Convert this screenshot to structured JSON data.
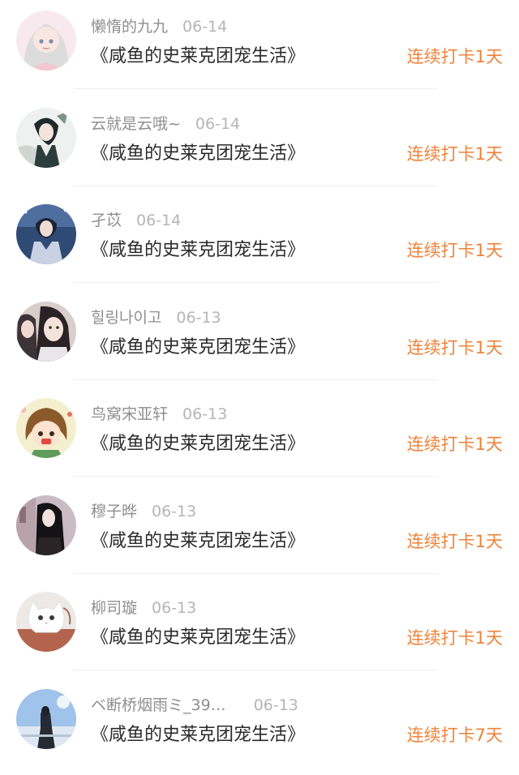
{
  "book_title": "《咸鱼的史莱克团宠生活》",
  "accent_color": "#f0833a",
  "entries": [
    {
      "username": "懒惰的九九",
      "date": "06-14",
      "streak": "连续打卡1天",
      "avatar_icon": "anime-girl-avatar"
    },
    {
      "username": "云就是云哦~",
      "date": "06-14",
      "streak": "连续打卡1天",
      "avatar_icon": "anime-boy-avatar"
    },
    {
      "username": "孑苡",
      "date": "06-14",
      "streak": "连续打卡1天",
      "avatar_icon": "anime-boy-night-avatar"
    },
    {
      "username": "힐링나이고",
      "date": "06-13",
      "streak": "连续打卡1天",
      "avatar_icon": "selfie-avatar"
    },
    {
      "username": "鸟窝宋亚轩",
      "date": "06-13",
      "streak": "连续打卡1天",
      "avatar_icon": "cartoon-girl-avatar"
    },
    {
      "username": "穆子晔",
      "date": "06-13",
      "streak": "连续打卡1天",
      "avatar_icon": "girl-photo-avatar"
    },
    {
      "username": "柳司璇",
      "date": "06-13",
      "streak": "连续打卡1天",
      "avatar_icon": "white-cat-avatar"
    },
    {
      "username": "ベ断桥烟雨ミ_39…",
      "date": "06-13",
      "streak": "连续打卡7天",
      "avatar_icon": "sky-silhouette-avatar"
    }
  ]
}
